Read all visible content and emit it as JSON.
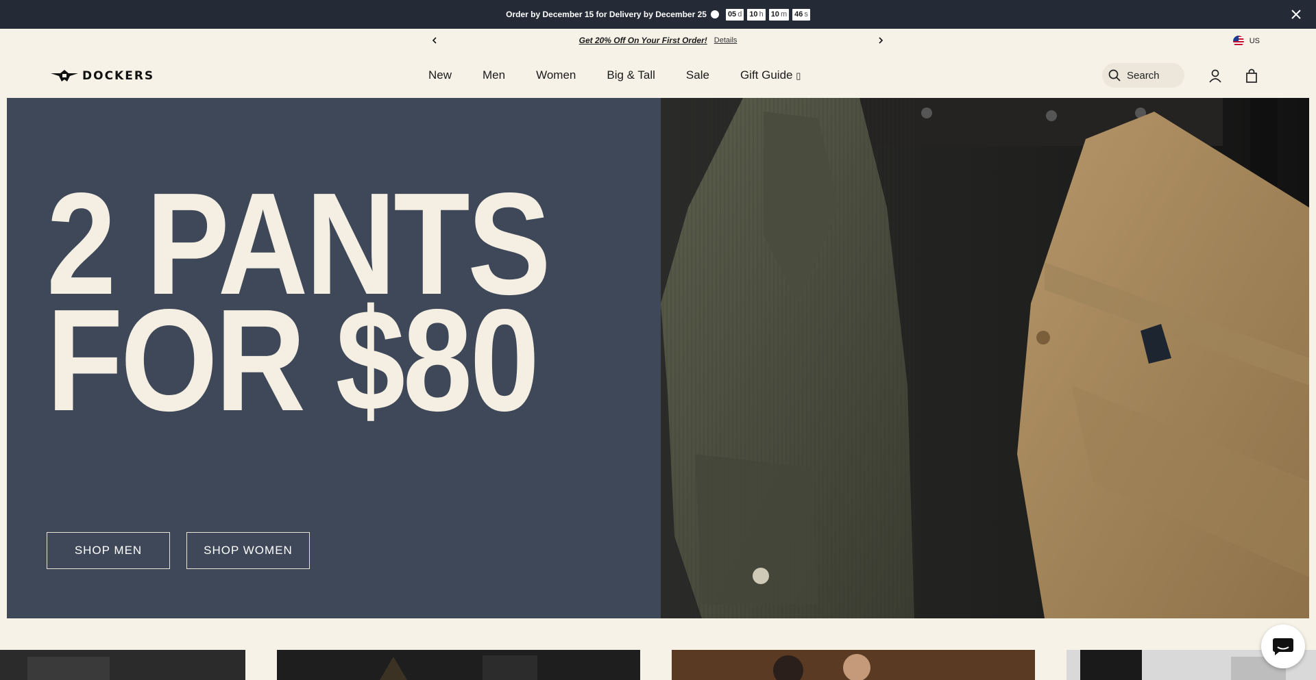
{
  "topbar": {
    "message": "Order by December 15 for Delivery by December 25",
    "countdown": [
      {
        "value": "05",
        "unit": "d"
      },
      {
        "value": "10",
        "unit": "h"
      },
      {
        "value": "10",
        "unit": "m"
      },
      {
        "value": "46",
        "unit": "s"
      }
    ]
  },
  "promo": {
    "text": "Get 20% Off On Your First Order!",
    "details": "Details",
    "locale": "US"
  },
  "brand": {
    "name": "DOCKERS"
  },
  "nav": {
    "items": [
      "New",
      "Men",
      "Women",
      "Big & Tall",
      "Sale",
      "Gift Guide"
    ],
    "gift_glyph": "▯"
  },
  "search": {
    "label": "Search"
  },
  "hero": {
    "headline_line1": "2 PANTS",
    "headline_line2": "FOR $80",
    "buttons": [
      "SHOP MEN",
      "SHOP WOMEN"
    ]
  },
  "colors": {
    "topbar": "#242a36",
    "hero_panel": "#3f4858",
    "page_bg": "#f6f2e7",
    "headline": "#f4efe2"
  }
}
